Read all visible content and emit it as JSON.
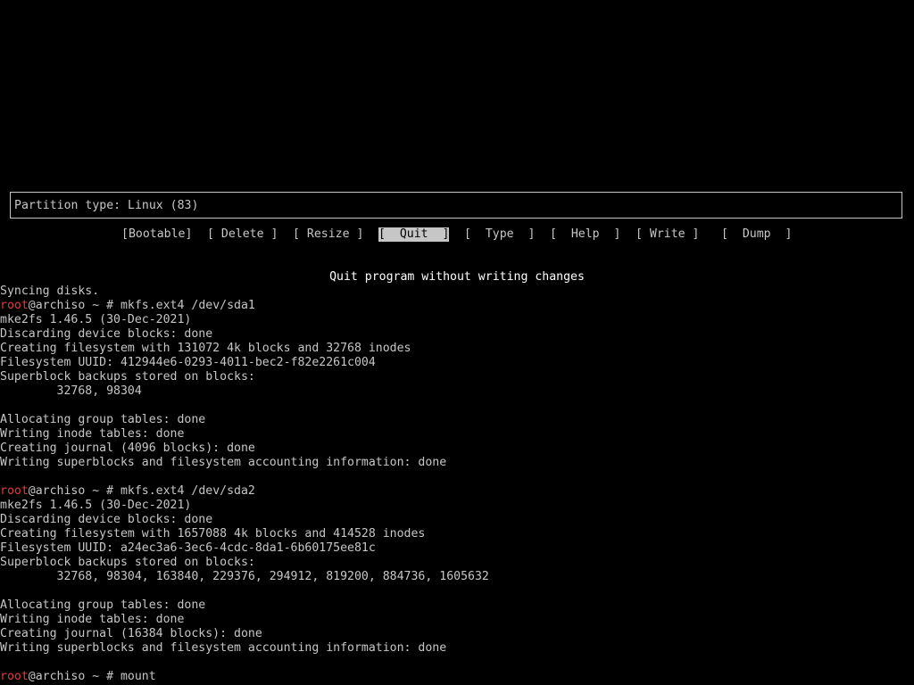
{
  "colors": {
    "background": "#000000",
    "text": "#c6c6c6",
    "highlight_bg": "#c6c6c6",
    "prompt_user": "#e03b3b"
  },
  "cfdisk": {
    "info": "Partition type: Linux (83)",
    "menu": [
      {
        "label": "[Bootable]",
        "selected": false
      },
      {
        "label": "[ Delete ]",
        "selected": false
      },
      {
        "label": "[ Resize ]",
        "selected": false
      },
      {
        "label": "[  Quit  ]",
        "selected": true
      },
      {
        "label": "[  Type  ]",
        "selected": false
      },
      {
        "label": "[  Help  ]",
        "selected": false
      },
      {
        "label": "[ Write ]",
        "selected": false
      },
      {
        "label": "[  Dump  ]",
        "selected": false
      }
    ],
    "description": "Quit program without writing changes"
  },
  "prompt": {
    "user": "root",
    "rest": "@archiso ~ # "
  },
  "console": [
    {
      "text": "Syncing disks."
    },
    {
      "prompt": true,
      "text": "mkfs.ext4 /dev/sda1"
    },
    {
      "text": "mke2fs 1.46.5 (30-Dec-2021)"
    },
    {
      "text": "Discarding device blocks: done"
    },
    {
      "text": "Creating filesystem with 131072 4k blocks and 32768 inodes"
    },
    {
      "text": "Filesystem UUID: 412944e6-0293-4011-bec2-f82e2261c004"
    },
    {
      "text": "Superblock backups stored on blocks:"
    },
    {
      "text": "        32768, 98304"
    },
    {
      "text": ""
    },
    {
      "text": "Allocating group tables: done"
    },
    {
      "text": "Writing inode tables: done"
    },
    {
      "text": "Creating journal (4096 blocks): done"
    },
    {
      "text": "Writing superblocks and filesystem accounting information: done"
    },
    {
      "text": ""
    },
    {
      "prompt": true,
      "text": "mkfs.ext4 /dev/sda2"
    },
    {
      "text": "mke2fs 1.46.5 (30-Dec-2021)"
    },
    {
      "text": "Discarding device blocks: done"
    },
    {
      "text": "Creating filesystem with 1657088 4k blocks and 414528 inodes"
    },
    {
      "text": "Filesystem UUID: a24ec3a6-3ec6-4cdc-8da1-6b60175ee81c"
    },
    {
      "text": "Superblock backups stored on blocks:"
    },
    {
      "text": "        32768, 98304, 163840, 229376, 294912, 819200, 884736, 1605632"
    },
    {
      "text": ""
    },
    {
      "text": "Allocating group tables: done"
    },
    {
      "text": "Writing inode tables: done"
    },
    {
      "text": "Creating journal (16384 blocks): done"
    },
    {
      "text": "Writing superblocks and filesystem accounting information: done"
    },
    {
      "text": ""
    },
    {
      "prompt": true,
      "text": "mount"
    }
  ]
}
